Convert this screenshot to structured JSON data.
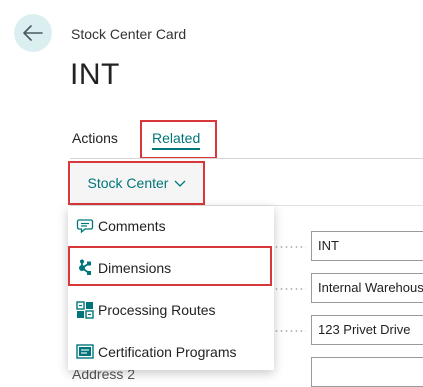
{
  "page": {
    "card_type": "Stock Center Card",
    "record_title": "INT"
  },
  "tabs": [
    {
      "label": "Actions",
      "active": false
    },
    {
      "label": "Related",
      "active": true
    }
  ],
  "menu": {
    "trigger_label": "Stock Center",
    "items": [
      {
        "label": "Comments",
        "icon": "comment-icon"
      },
      {
        "label": "Dimensions",
        "icon": "dimensions-icon"
      },
      {
        "label": "Processing Routes",
        "icon": "processing-routes-icon"
      },
      {
        "label": "Certification Programs",
        "icon": "certification-programs-icon"
      }
    ]
  },
  "form": {
    "fields": [
      {
        "value": "INT"
      },
      {
        "value": "Internal Warehouse"
      },
      {
        "value": "123 Privet Drive"
      },
      {
        "value": ""
      }
    ],
    "partial_label": "Address 2"
  },
  "colors": {
    "accent": "#00767a",
    "highlight": "#d9383a",
    "back_button_bg": "#dceff0"
  }
}
